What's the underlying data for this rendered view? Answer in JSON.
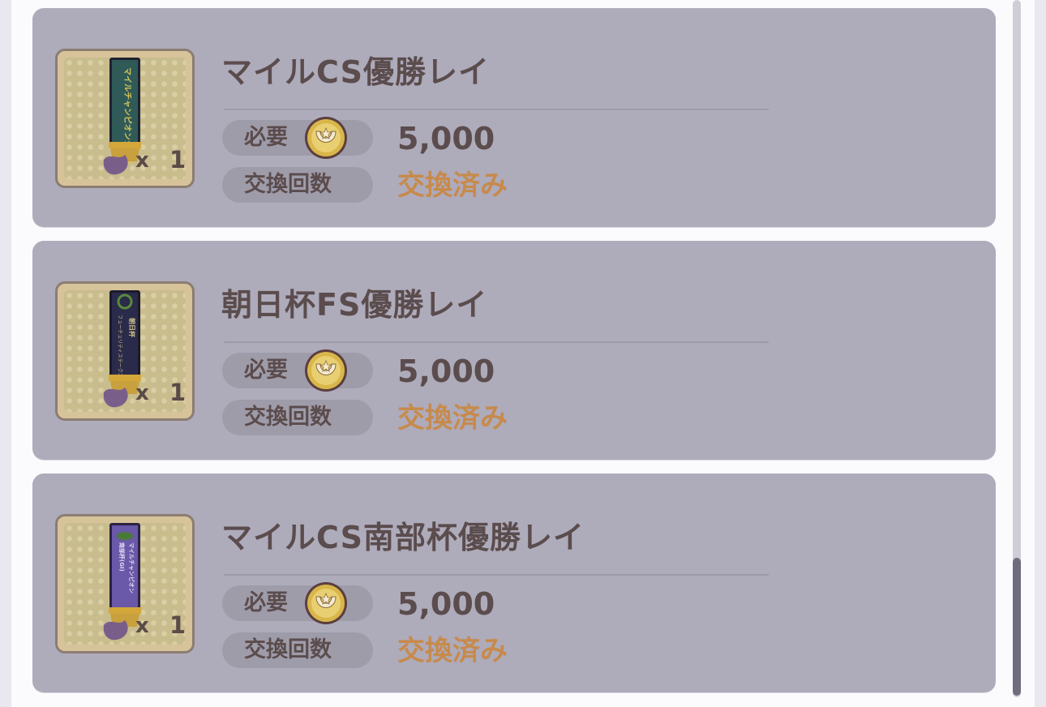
{
  "items": [
    {
      "name": "マイルCS優勝レイ",
      "quantity_x": "x",
      "quantity": "1",
      "required_label": "必要",
      "cost": "5,000",
      "exchange_label": "交換回数",
      "status": "交換済み",
      "lei_color": "#2f5a58",
      "lei_text_color": "#d8c25a"
    },
    {
      "name": "朝日杯FS優勝レイ",
      "quantity_x": "x",
      "quantity": "1",
      "required_label": "必要",
      "cost": "5,000",
      "exchange_label": "交換回数",
      "status": "交換済み",
      "lei_color": "#2a2a4a",
      "lei_text_color": "#cfc28a"
    },
    {
      "name": "マイルCS南部杯優勝レイ",
      "quantity_x": "x",
      "quantity": "1",
      "required_label": "必要",
      "cost": "5,000",
      "exchange_label": "交換回数",
      "status": "交換済み",
      "lei_color": "#6a58a8",
      "lei_text_color": "#e0d8f0"
    }
  ],
  "icons": {
    "currency": "horseshoe-coin-icon",
    "item": "lei-icon"
  },
  "colors": {
    "card_bg": "#aeabbb",
    "status_text": "#c78a4b",
    "title_text": "#5b4c4d"
  }
}
